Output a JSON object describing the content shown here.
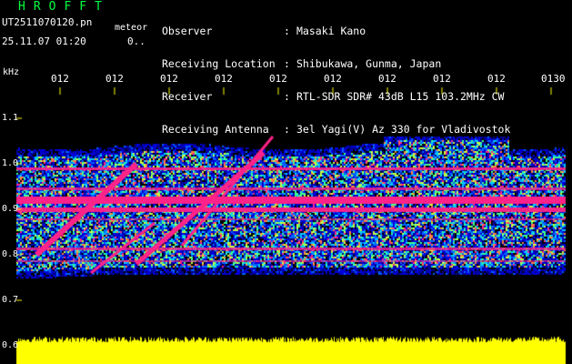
{
  "header": {
    "title": "HROFFT",
    "filename": "UT2511070120.pn",
    "detector": "meteor",
    "datetime": "25.11.07 01:20",
    "counter": "0.."
  },
  "info": [
    {
      "label": "Observer",
      "sep": ":",
      "value": "Masaki Kano"
    },
    {
      "label": "Receiving Location",
      "sep": ":",
      "value": "Shibukawa, Gunma, Japan"
    },
    {
      "label": "Receiver",
      "sep": ":",
      "value": "RTL-SDR SDR# 43dB L15 103.2MHz CW"
    },
    {
      "label": "Receiving Antenna",
      "sep": ":",
      "value": "3el Yagi(V) Az 330 for Vladivostok"
    }
  ],
  "axes": {
    "y_unit": "kHz",
    "y_ticks": [
      "1.1",
      "1.0",
      "0.9",
      "0.8",
      "0.7",
      "0.6"
    ],
    "x_ticks": [
      "012",
      "012",
      "012",
      "012",
      "012",
      "012",
      "012",
      "012",
      "012",
      "0130"
    ]
  },
  "colors": {
    "background": "#000000",
    "title": "#00ff40",
    "text": "#ffffff",
    "tick": "#ffff00",
    "echo": "#ff2288",
    "noise_low": "#0000c0",
    "noise_mid": "#00c0ff",
    "noise_high": "#40ff80",
    "amplitude": "#ffff00"
  }
}
